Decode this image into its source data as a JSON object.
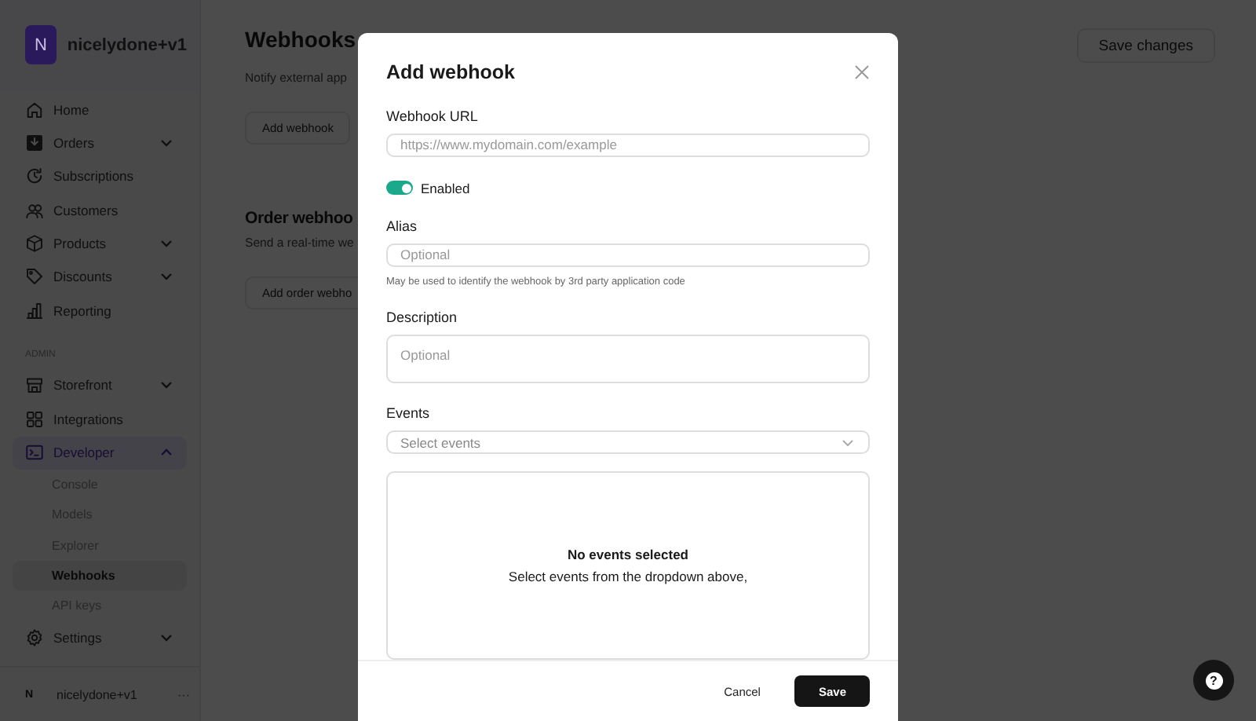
{
  "workspace": {
    "initial": "N",
    "name": "nicelydone+v1"
  },
  "nav_sections": [
    {
      "items": [
        {
          "label": "Home",
          "selected": false
        },
        {
          "label": "Orders",
          "selected": false,
          "expanded": false
        },
        {
          "label": "Subscriptions",
          "selected": false
        },
        {
          "label": "Customers",
          "selected": false
        },
        {
          "label": "Products",
          "selected": false,
          "expanded": false
        },
        {
          "label": "Discounts",
          "selected": false,
          "expanded": false
        },
        {
          "label": "Reporting",
          "selected": false
        }
      ]
    },
    {
      "heading": "ADMIN",
      "items": [
        {
          "label": "Storefront",
          "selected": false,
          "expanded": false
        },
        {
          "label": "Integrations",
          "selected": false
        },
        {
          "label": "Developer",
          "selected": true,
          "expanded": true,
          "children": [
            {
              "label": "Console",
              "selected": false
            },
            {
              "label": "Models",
              "selected": false
            },
            {
              "label": "Explorer",
              "selected": false
            },
            {
              "label": "Webhooks",
              "selected": true
            },
            {
              "label": "API keys",
              "selected": false
            }
          ]
        },
        {
          "label": "Settings",
          "selected": false,
          "expanded": false
        }
      ]
    }
  ],
  "user": {
    "initial": "N",
    "name": "nicelydone+v1",
    "menu": "···"
  },
  "page": {
    "title": "Webhooks",
    "subtitle": "Notify external app",
    "button": "Add webhook",
    "header_button": "Save changes",
    "section": {
      "title": "Order webhoo",
      "subtitle": "Send a real-time we",
      "button": "Add order webho"
    }
  },
  "modal": {
    "title": "Add webhook",
    "url": {
      "label": "Webhook URL",
      "placeholder": "https://www.mydomain.com/example"
    },
    "enabled": {
      "label": "Enabled",
      "on": true
    },
    "alias": {
      "label": "Alias",
      "placeholder": "Optional",
      "hint": "May be used to identify the webhook by 3rd party application code"
    },
    "description": {
      "label": "Description",
      "placeholder": "Optional"
    },
    "events": {
      "label": "Events",
      "placeholder": "Select events",
      "empty_title": "No events selected",
      "empty_text": "Select events from the dropdown above,"
    },
    "buttons": {
      "cancel": "Cancel",
      "save": "Save"
    }
  },
  "help_button": "?"
}
